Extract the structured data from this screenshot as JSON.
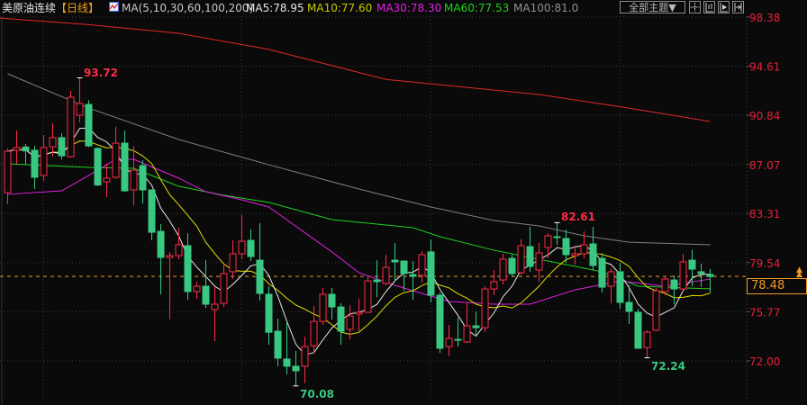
{
  "header": {
    "title": "美原油连续",
    "period": "【日线】",
    "ma_params": "MA(5,10,30,60,100,200)",
    "ma5": "MA5:78.95",
    "ma10": "MA10:77.60",
    "ma30": "MA30:78.30",
    "ma60": "MA60:77.53",
    "ma100": "MA100:81.0",
    "theme_button": "全部主题▼"
  },
  "toolbar_icons": [
    "crosshair-icon",
    "range-icon",
    "play-icon",
    "move-right-icon"
  ],
  "colors": {
    "up": "#ff2a46",
    "down": "#38c882",
    "ma5": "#e8e8e8",
    "ma10": "#e0e000",
    "ma30": "#e020e0",
    "ma60": "#20d020",
    "ma100": "#808080",
    "ma200": "#e02828",
    "last": "#f0962a",
    "axis": "#e8203a"
  },
  "chart_data": {
    "type": "candlestick",
    "title": "美原油连续 日线",
    "y_ticks": [
      "98.38",
      "94.61",
      "90.84",
      "87.07",
      "83.31",
      "79.54",
      "75.77",
      "72.00"
    ],
    "ylim": [
      72.0,
      98.38
    ],
    "last_price": "78.48",
    "annotations": {
      "high1": "93.72",
      "high2": "82.61",
      "low1": "70.08",
      "low2": "72.24"
    },
    "candles": [
      [
        84.91,
        88.3,
        84.02,
        88.09
      ],
      [
        88.16,
        89.68,
        87.12,
        88.37
      ],
      [
        88.41,
        88.64,
        87.05,
        88.11
      ],
      [
        88.16,
        88.5,
        85.2,
        86.09
      ],
      [
        86.23,
        89.33,
        85.81,
        88.37
      ],
      [
        88.43,
        90.23,
        87.67,
        89.13
      ],
      [
        89.13,
        89.47,
        87.47,
        87.74
      ],
      [
        87.67,
        92.72,
        87.6,
        92.23
      ],
      [
        90.85,
        93.72,
        90.3,
        91.75
      ],
      [
        91.68,
        92.0,
        88.4,
        88.5
      ],
      [
        88.3,
        88.4,
        85.4,
        85.5
      ],
      [
        85.74,
        87.12,
        84.57,
        86.02
      ],
      [
        86.09,
        89.96,
        85.98,
        88.71
      ],
      [
        88.71,
        89.68,
        84.98,
        85.05
      ],
      [
        85.12,
        88.5,
        83.95,
        86.64
      ],
      [
        86.98,
        87.4,
        84.08,
        85.12
      ],
      [
        85.12,
        85.12,
        81.25,
        81.87
      ],
      [
        81.94,
        82.5,
        77.1,
        79.94
      ],
      [
        79.94,
        80.36,
        75.18,
        80.08
      ],
      [
        80.08,
        82.22,
        79.8,
        80.91
      ],
      [
        80.84,
        81.8,
        76.7,
        77.32
      ],
      [
        77.32,
        78.08,
        76.77,
        77.73
      ],
      [
        77.73,
        79.73,
        76.07,
        76.35
      ],
      [
        75.94,
        77.66,
        73.52,
        76.35
      ],
      [
        76.42,
        79.46,
        76.14,
        78.7
      ],
      [
        78.84,
        81.25,
        78.28,
        80.22
      ],
      [
        80.22,
        83.19,
        79.8,
        81.18
      ],
      [
        81.25,
        82.08,
        79.66,
        80.01
      ],
      [
        79.73,
        82.57,
        76.63,
        77.18
      ],
      [
        77.11,
        77.73,
        73.24,
        74.2
      ],
      [
        74.28,
        75.24,
        71.59,
        72.21
      ],
      [
        72.14,
        75.0,
        70.96,
        71.59
      ],
      [
        71.59,
        72.76,
        70.08,
        71.24
      ],
      [
        71.59,
        73.86,
        70.3,
        73.1
      ],
      [
        73.17,
        76.21,
        72.55,
        75.03
      ],
      [
        75.03,
        77.59,
        74.76,
        77.11
      ],
      [
        77.11,
        77.59,
        75.17,
        76.14
      ],
      [
        76.14,
        76.42,
        73.24,
        74.28
      ],
      [
        74.42,
        76.28,
        73.65,
        75.45
      ],
      [
        75.59,
        76.76,
        74.28,
        75.73
      ],
      [
        75.73,
        78.42,
        75.73,
        78.14
      ],
      [
        78.21,
        79.73,
        76.9,
        78.08
      ],
      [
        77.94,
        80.15,
        77.8,
        79.18
      ],
      [
        79.73,
        81.05,
        78.14,
        79.6
      ],
      [
        79.66,
        79.73,
        77.38,
        78.7
      ],
      [
        78.63,
        79.66,
        76.7,
        78.49
      ],
      [
        78.56,
        80.4,
        78.0,
        80.15
      ],
      [
        80.36,
        81.32,
        76.49,
        77.04
      ],
      [
        77.04,
        77.25,
        72.62,
        72.97
      ],
      [
        73.1,
        74.76,
        72.35,
        73.72
      ],
      [
        73.65,
        75.31,
        73.1,
        73.58
      ],
      [
        73.45,
        76.49,
        73.38,
        74.69
      ],
      [
        74.69,
        75.8,
        73.93,
        74.55
      ],
      [
        74.55,
        77.73,
        74.2,
        77.52
      ],
      [
        77.52,
        78.97,
        77.04,
        78.08
      ],
      [
        78.21,
        80.22,
        77.87,
        79.8
      ],
      [
        79.87,
        80.15,
        78.42,
        78.7
      ],
      [
        78.77,
        81.32,
        78.63,
        80.84
      ],
      [
        80.77,
        82.29,
        78.84,
        79.25
      ],
      [
        78.97,
        81.05,
        78.08,
        80.29
      ],
      [
        80.7,
        81.8,
        79.87,
        81.6
      ],
      [
        81.53,
        82.61,
        80.9,
        81.46
      ],
      [
        81.39,
        82.08,
        79.53,
        80.15
      ],
      [
        80.08,
        80.84,
        79.4,
        80.22
      ],
      [
        80.22,
        81.94,
        79.87,
        80.91
      ],
      [
        80.98,
        82.29,
        78.97,
        79.32
      ],
      [
        79.87,
        80.29,
        77.25,
        77.66
      ],
      [
        77.73,
        79.11,
        76.42,
        78.84
      ],
      [
        78.84,
        79.53,
        76.0,
        76.49
      ],
      [
        76.49,
        77.8,
        74.83,
        75.8
      ],
      [
        75.73,
        76.0,
        72.97,
        72.97
      ],
      [
        73.03,
        74.35,
        72.24,
        74.21
      ],
      [
        74.35,
        77.59,
        74.28,
        77.38
      ],
      [
        77.32,
        78.42,
        77.04,
        78.28
      ],
      [
        78.21,
        78.56,
        76.35,
        77.52
      ],
      [
        77.52,
        80.22,
        77.38,
        79.6
      ],
      [
        79.73,
        80.5,
        77.73,
        79.04
      ],
      [
        78.84,
        79.46,
        77.66,
        78.7
      ],
      [
        78.63,
        79.04,
        77.25,
        78.48
      ]
    ],
    "ma_lines": {
      "ma200": [
        [
          -1,
          98.31
        ],
        [
          9,
          97.8
        ],
        [
          19,
          97.14
        ],
        [
          29,
          95.9
        ],
        [
          42,
          93.6
        ],
        [
          59,
          92.44
        ],
        [
          69,
          91.4
        ],
        [
          78,
          90.37
        ]
      ],
      "ma100": [
        [
          0,
          94.03
        ],
        [
          9,
          91.4
        ],
        [
          19,
          88.99
        ],
        [
          29,
          87.05
        ],
        [
          39,
          85.19
        ],
        [
          47,
          83.81
        ],
        [
          54,
          82.77
        ],
        [
          59,
          82.36
        ],
        [
          64,
          81.6
        ],
        [
          69,
          81.11
        ],
        [
          78,
          80.91
        ]
      ],
      "ma60": [
        [
          0,
          87.12
        ],
        [
          9,
          86.85
        ],
        [
          14,
          86.78
        ],
        [
          19,
          85.4
        ],
        [
          24,
          84.71
        ],
        [
          29,
          84.16
        ],
        [
          36,
          82.84
        ],
        [
          45,
          82.22
        ],
        [
          48,
          81.53
        ],
        [
          54,
          80.49
        ],
        [
          59,
          79.8
        ],
        [
          66,
          78.84
        ],
        [
          70,
          77.73
        ],
        [
          78,
          77.53
        ]
      ],
      "ma30": [
        [
          0,
          84.78
        ],
        [
          6,
          85.05
        ],
        [
          9,
          86.23
        ],
        [
          12,
          87.47
        ],
        [
          14,
          87.47
        ],
        [
          19,
          86.02
        ],
        [
          22,
          84.98
        ],
        [
          26,
          84.36
        ],
        [
          29,
          83.81
        ],
        [
          36,
          80.36
        ],
        [
          39,
          78.77
        ],
        [
          43,
          77.8
        ],
        [
          49,
          76.56
        ],
        [
          54,
          76.35
        ],
        [
          58,
          76.35
        ],
        [
          63,
          77.45
        ],
        [
          68,
          78.14
        ],
        [
          73,
          77.73
        ],
        [
          78,
          78.28
        ]
      ]
    }
  }
}
